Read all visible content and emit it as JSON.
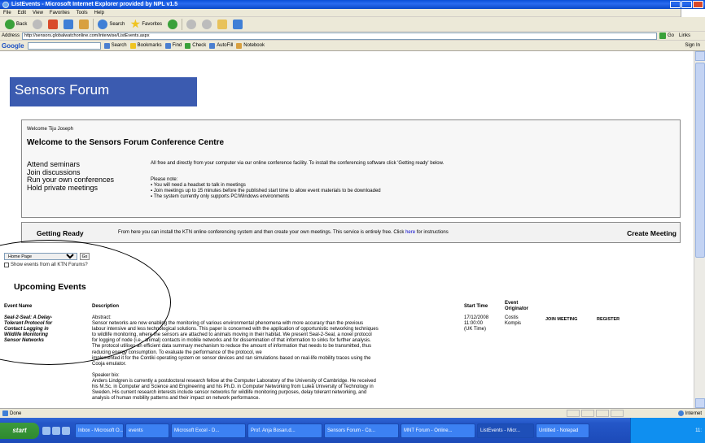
{
  "window": {
    "title": "ListEvents - Microsoft Internet Explorer provided by NPL v1.5"
  },
  "menu": [
    "File",
    "Edit",
    "View",
    "Favorites",
    "Tools",
    "Help"
  ],
  "toolbar": {
    "back": "Back",
    "search": "Search",
    "favorites": "Favorites"
  },
  "address": {
    "label": "Address",
    "url": "http://sensors.globalwatchonline.com/interwise/ListEvents.aspx",
    "go": "Go",
    "links": "Links"
  },
  "googlebar": {
    "logo": "Google",
    "search": "Search",
    "bookmarks": "Bookmarks",
    "find": "Find",
    "check": "Check",
    "autofill": "AutoFill",
    "notebook": "Notebook",
    "signin": "Sign In"
  },
  "page": {
    "banner": "Sensors Forum",
    "welcome_user": "Welcome Tiju Joseph",
    "welcome_title": "Welcome to the Sensors Forum Conference Centre",
    "features": [
      "Attend seminars",
      "Join discussions",
      "Run your own conferences",
      "Hold private meetings"
    ],
    "intro": "All free and directly from your computer via our online conference facility. To install the conferencing software click 'Getting ready' below.",
    "note_label": "Please note:",
    "notes": [
      "You will need a headset to talk in meetings",
      "Join meetings up to 15 minutes before the published start time to allow event materials to be downloaded",
      "The system currently only supports PC/Windows environments"
    ],
    "getting_ready": "Getting Ready",
    "getting_text_before": "From here you can install the KTN online conferencing system and then create your own meetings. This service is entirely free. Click ",
    "getting_link": "here",
    "getting_text_after": " for instructions",
    "create_meeting": "Create Meeting",
    "forum_select": "Home Page",
    "go_button": "Go",
    "show_all": "Show events from all KTN Forums?",
    "upcoming": "Upcoming Events"
  },
  "events": {
    "headers": {
      "name": "Event Name",
      "description": "Description",
      "start": "Start Time",
      "originator": "Event Originator"
    },
    "rows": [
      {
        "name_lines": [
          "Seal-2-Seal: A Delay-",
          "Tolerant Protocol for",
          "Contact Logging in",
          "Wildlife Monitoring",
          "Sensor Networks"
        ],
        "desc_lines": [
          "Abstract:",
          "Sensor networks are now enabling the monitoring of various environmental phenomena with more accuracy than the previous",
          "labour intensive and less technological solutions. This paper is concerned with the application of opportunistic networking techniques",
          "to wildlife monitoring, where the sensors are attached to animals moving in their habitat. We present Seal-2-Seal, a novel protocol",
          "for logging of node (i.e., animal) contacts in mobile networks and for dissemination of that information to sinks for further analysis.",
          "The protocol utilises an efficient data summary mechanism to reduce the amount of information that needs to be transmitted, thus",
          "reducing energy consumption. To evaluate the performance of the protocol, we",
          "implemented it for the Contiki operating system on sensor devices and ran simulations based on real-life mobility traces using the",
          "Cooja emulator.",
          "",
          "Speaker bio:",
          "Anders Lindgren is currently a postdoctoral research fellow at the Computer Laboratory of the University of Cambridge. He received",
          "his M.Sc. in Computer and Science and Engineering and his Ph.D. in Computer Networking from Luleå University of Technology in",
          "Sweden. His current research interests include sensor networks for wildlife monitoring purposes, delay tolerant networking, and",
          "analysis of human mobility patterns and their impact on network performance."
        ],
        "start_lines": [
          "17/12/2008",
          "11:00:00",
          "(UK Time)"
        ],
        "originator_lines": [
          "Costis",
          "Kompis"
        ],
        "join": "JOIN MEETING",
        "register": "REGISTER"
      }
    ]
  },
  "status": {
    "text": "Done",
    "zone": "Internet"
  },
  "taskbar": {
    "start": "start",
    "tasks": [
      "Inbox - Microsoft O...",
      "events",
      "Microsoft Excel - D...",
      "Prof. Anja Bosan.d...",
      "Sensors Forum - Co...",
      "MNT Forum - Online...",
      "ListEvents - Micr...",
      "Untitled - Notepad"
    ],
    "clock": "11:"
  }
}
